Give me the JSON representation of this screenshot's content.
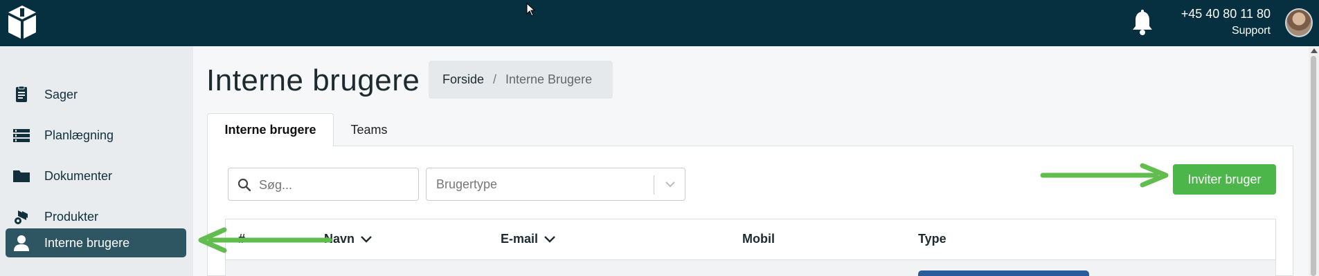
{
  "header": {
    "phone": "+45 40 80 11 80",
    "support_label": "Support"
  },
  "sidebar": {
    "items": [
      {
        "label": "Sager",
        "icon": "document-icon",
        "active": false
      },
      {
        "label": "Planlægning",
        "icon": "list-icon",
        "active": false
      },
      {
        "label": "Dokumenter",
        "icon": "folder-icon",
        "active": false
      },
      {
        "label": "Produkter",
        "icon": "products-icon",
        "active": false
      },
      {
        "label": "Interne brugere",
        "icon": "user-icon",
        "active": true
      }
    ]
  },
  "page": {
    "title": "Interne brugere",
    "breadcrumb": {
      "home": "Forside",
      "separator": "/",
      "current": "Interne Brugere"
    }
  },
  "tabs": [
    {
      "label": "Interne brugere",
      "active": true
    },
    {
      "label": "Teams",
      "active": false
    }
  ],
  "filters": {
    "search_placeholder": "Søg...",
    "user_type_placeholder": "Brugertype"
  },
  "actions": {
    "invite_label": "Inviter bruger"
  },
  "table": {
    "columns": [
      {
        "label": "#",
        "sortable": false
      },
      {
        "label": "Navn",
        "sortable": true
      },
      {
        "label": "E-mail",
        "sortable": true
      },
      {
        "label": "Mobil",
        "sortable": false
      },
      {
        "label": "Type",
        "sortable": false
      }
    ]
  },
  "colors": {
    "topbar": "#062f3f",
    "active_nav": "#2d5662",
    "primary_green": "#4cb64a",
    "annotation_arrow": "#62bd4f"
  }
}
